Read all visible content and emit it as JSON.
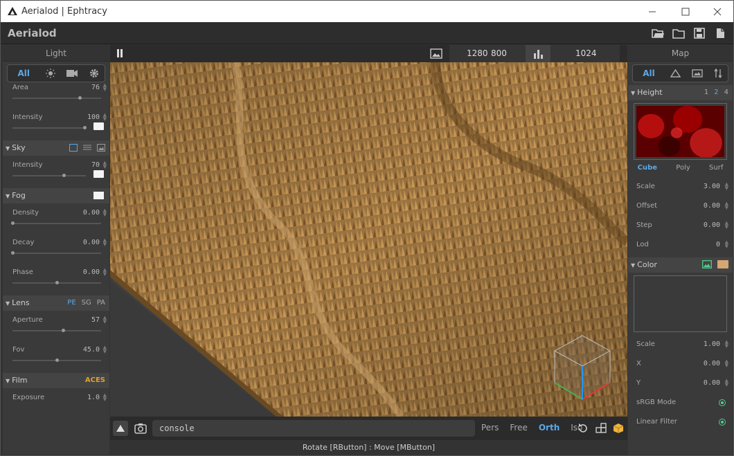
{
  "window": {
    "title": "Aerialod | Ephtracy"
  },
  "app": {
    "name": "Aerialod",
    "toolbar": [
      "open-folder-icon",
      "folder-icon",
      "save-icon",
      "file-icon"
    ]
  },
  "left_panel": {
    "header": "Light",
    "tabs": [
      "All",
      "sun-icon",
      "camera-icon",
      "gear-icon"
    ],
    "active_tab": "All",
    "light": {
      "area": {
        "label": "Area",
        "value": "76",
        "fill": 0.76
      },
      "intensity": {
        "label": "Intensity",
        "value": "100",
        "fill": 1.0
      }
    },
    "sky": {
      "title": "Sky",
      "intensity": {
        "label": "Intensity",
        "value": "70",
        "fill": 0.6
      }
    },
    "fog": {
      "title": "Fog",
      "density": {
        "label": "Density",
        "value": "0.00",
        "fill": 0.0
      },
      "decay": {
        "label": "Decay",
        "value": "0.00",
        "fill": 0.0
      },
      "phase": {
        "label": "Phase",
        "value": "0.00",
        "fill": 0.5
      }
    },
    "lens": {
      "title": "Lens",
      "modes": [
        "PE",
        "SG",
        "PA"
      ],
      "active_mode": "PE",
      "aperture": {
        "label": "Aperture",
        "value": "57",
        "fill": 0.57
      },
      "fov": {
        "label": "Fov",
        "value": "45.0",
        "fill": 0.5
      }
    },
    "film": {
      "title": "Film",
      "badge": "ACES",
      "exposure": {
        "label": "Exposure",
        "value": "1.0"
      }
    }
  },
  "viewport": {
    "width": "1280",
    "height": "800",
    "samples": "1024",
    "console_placeholder": "console",
    "camera_modes": [
      "Pers",
      "Free",
      "Orth",
      "Iso"
    ],
    "active_camera_mode": "Orth",
    "status": "Rotate [RButton] : Move [MButton]"
  },
  "right_panel": {
    "header": "Map",
    "tabs": [
      "All",
      "terrain-icon",
      "image-icon",
      "sort-icon"
    ],
    "active_tab": "All",
    "height": {
      "title": "Height",
      "levels": [
        "1",
        "2",
        "4"
      ],
      "active_level": "2",
      "shapes": [
        "Cube",
        "Poly",
        "Surf"
      ],
      "active_shape": "Cube",
      "scale": {
        "label": "Scale",
        "value": "3.00"
      },
      "offset": {
        "label": "Offset",
        "value": "0.00"
      },
      "step": {
        "label": "Step",
        "value": "0.00"
      },
      "lod": {
        "label": "Lod",
        "value": "0"
      }
    },
    "color": {
      "title": "Color",
      "swatch": "#d6a673",
      "scale": {
        "label": "Scale",
        "value": "1.00"
      },
      "x": {
        "label": "X",
        "value": "0.00"
      },
      "y": {
        "label": "Y",
        "value": "0.00"
      },
      "srgb": {
        "label": "sRGB Mode"
      },
      "linear": {
        "label": "Linear Filter"
      }
    }
  }
}
